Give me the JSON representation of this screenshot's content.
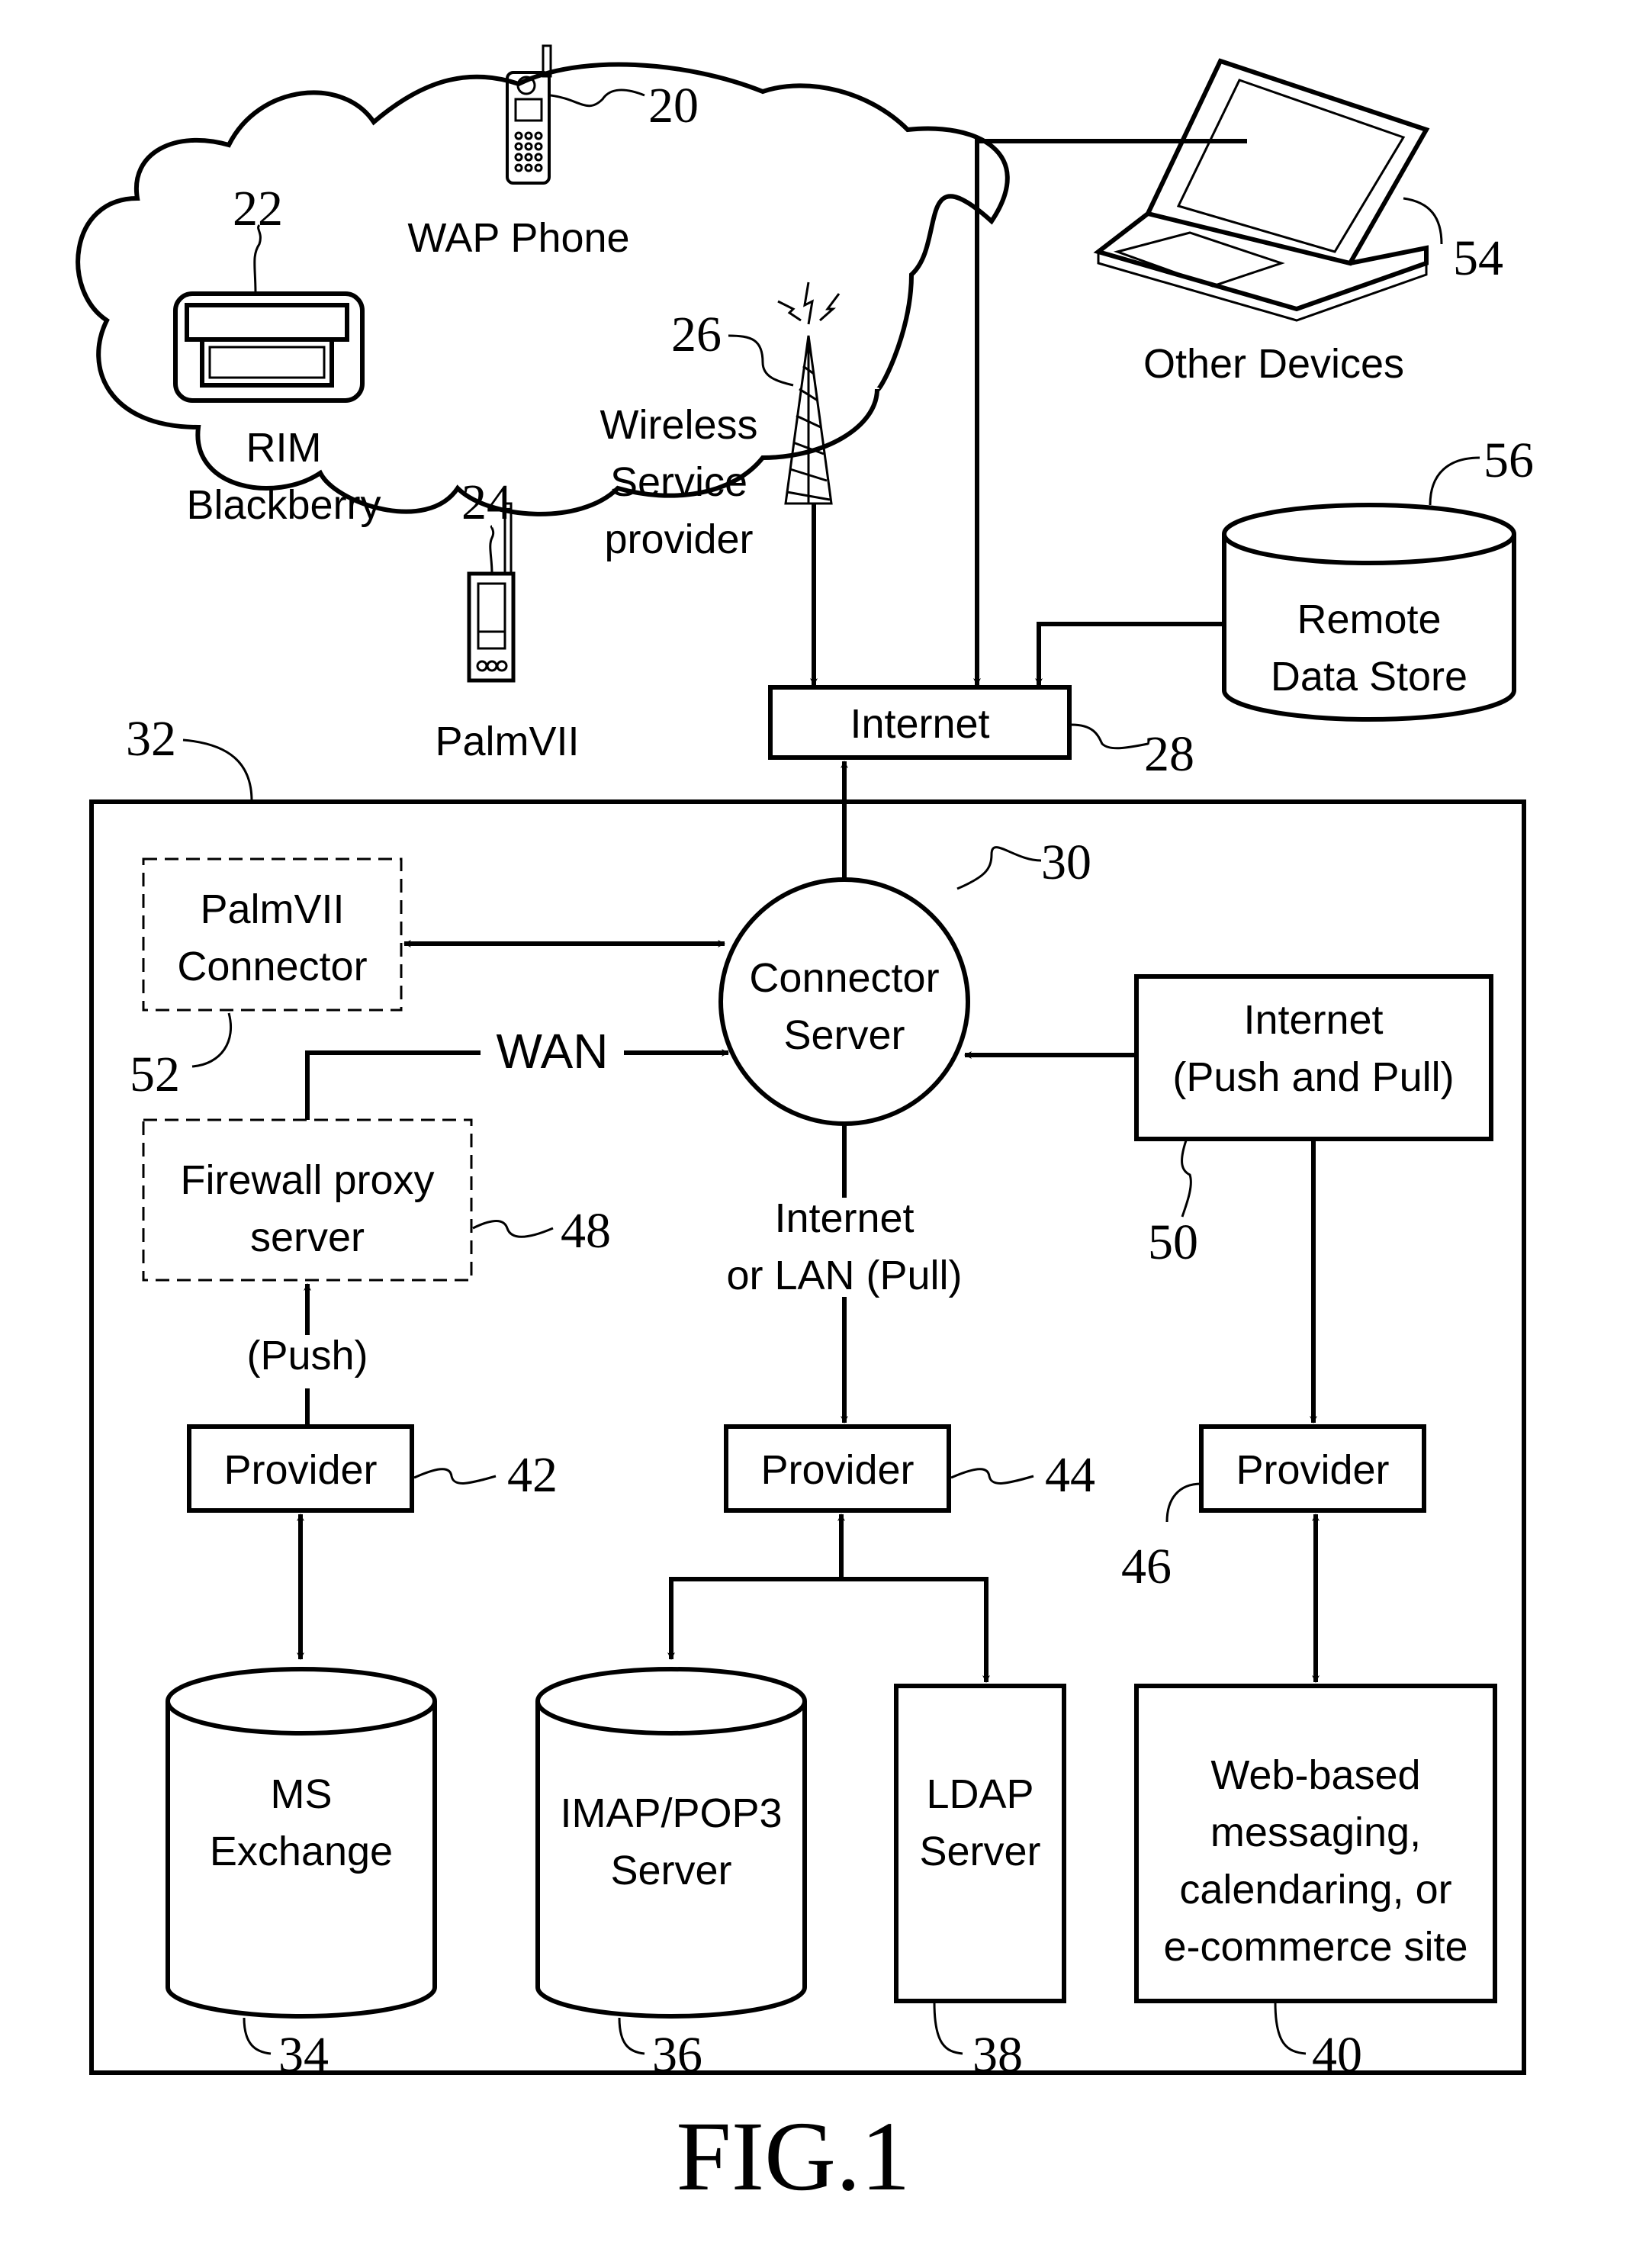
{
  "figure": {
    "caption": "FIG.1",
    "nodes": {
      "wap_phone": {
        "label": "WAP Phone",
        "ref": "20"
      },
      "rim_blackberry": {
        "label1": "RIM",
        "label2": "Blackberry",
        "ref": "22"
      },
      "palm_vii": {
        "label": "PalmVII",
        "ref": "24"
      },
      "wireless_provider": {
        "label1": "Wireless",
        "label2": "Service",
        "label3": "provider",
        "ref": "26"
      },
      "internet_top": {
        "label": "Internet",
        "ref": "28"
      },
      "connector_server": {
        "label1": "Connector",
        "label2": "Server",
        "ref": "30"
      },
      "enterprise_boundary": {
        "ref": "32"
      },
      "ms_exchange": {
        "label1": "MS",
        "label2": "Exchange",
        "ref": "34"
      },
      "imap_pop3": {
        "label1": "IMAP/POP3",
        "label2": "Server",
        "ref": "36"
      },
      "ldap": {
        "label1": "LDAP",
        "label2": "Server",
        "ref": "38"
      },
      "web_site": {
        "label1": "Web-based",
        "label2": "messaging,",
        "label3": "calendaring, or",
        "label4": "e-commerce site",
        "ref": "40"
      },
      "provider_42": {
        "label": "Provider",
        "ref": "42"
      },
      "provider_44": {
        "label": "Provider",
        "ref": "44"
      },
      "provider_46": {
        "label": "Provider",
        "ref": "46"
      },
      "firewall_proxy": {
        "label1": "Firewall proxy",
        "label2": "server",
        "ref": "48"
      },
      "internet_push_pull": {
        "label1": "Internet",
        "label2": "(Push and Pull)",
        "ref": "50"
      },
      "palm_connector": {
        "label1": "PalmVII",
        "label2": "Connector",
        "ref": "52"
      },
      "other_devices": {
        "label": "Other Devices",
        "ref": "54"
      },
      "remote_data_store": {
        "label1": "Remote",
        "label2": "Data Store",
        "ref": "56"
      }
    },
    "edge_labels": {
      "wan": "WAN",
      "push": "(Push)",
      "lan_pull_1": "Internet",
      "lan_pull_2": "or LAN (Pull)"
    }
  }
}
